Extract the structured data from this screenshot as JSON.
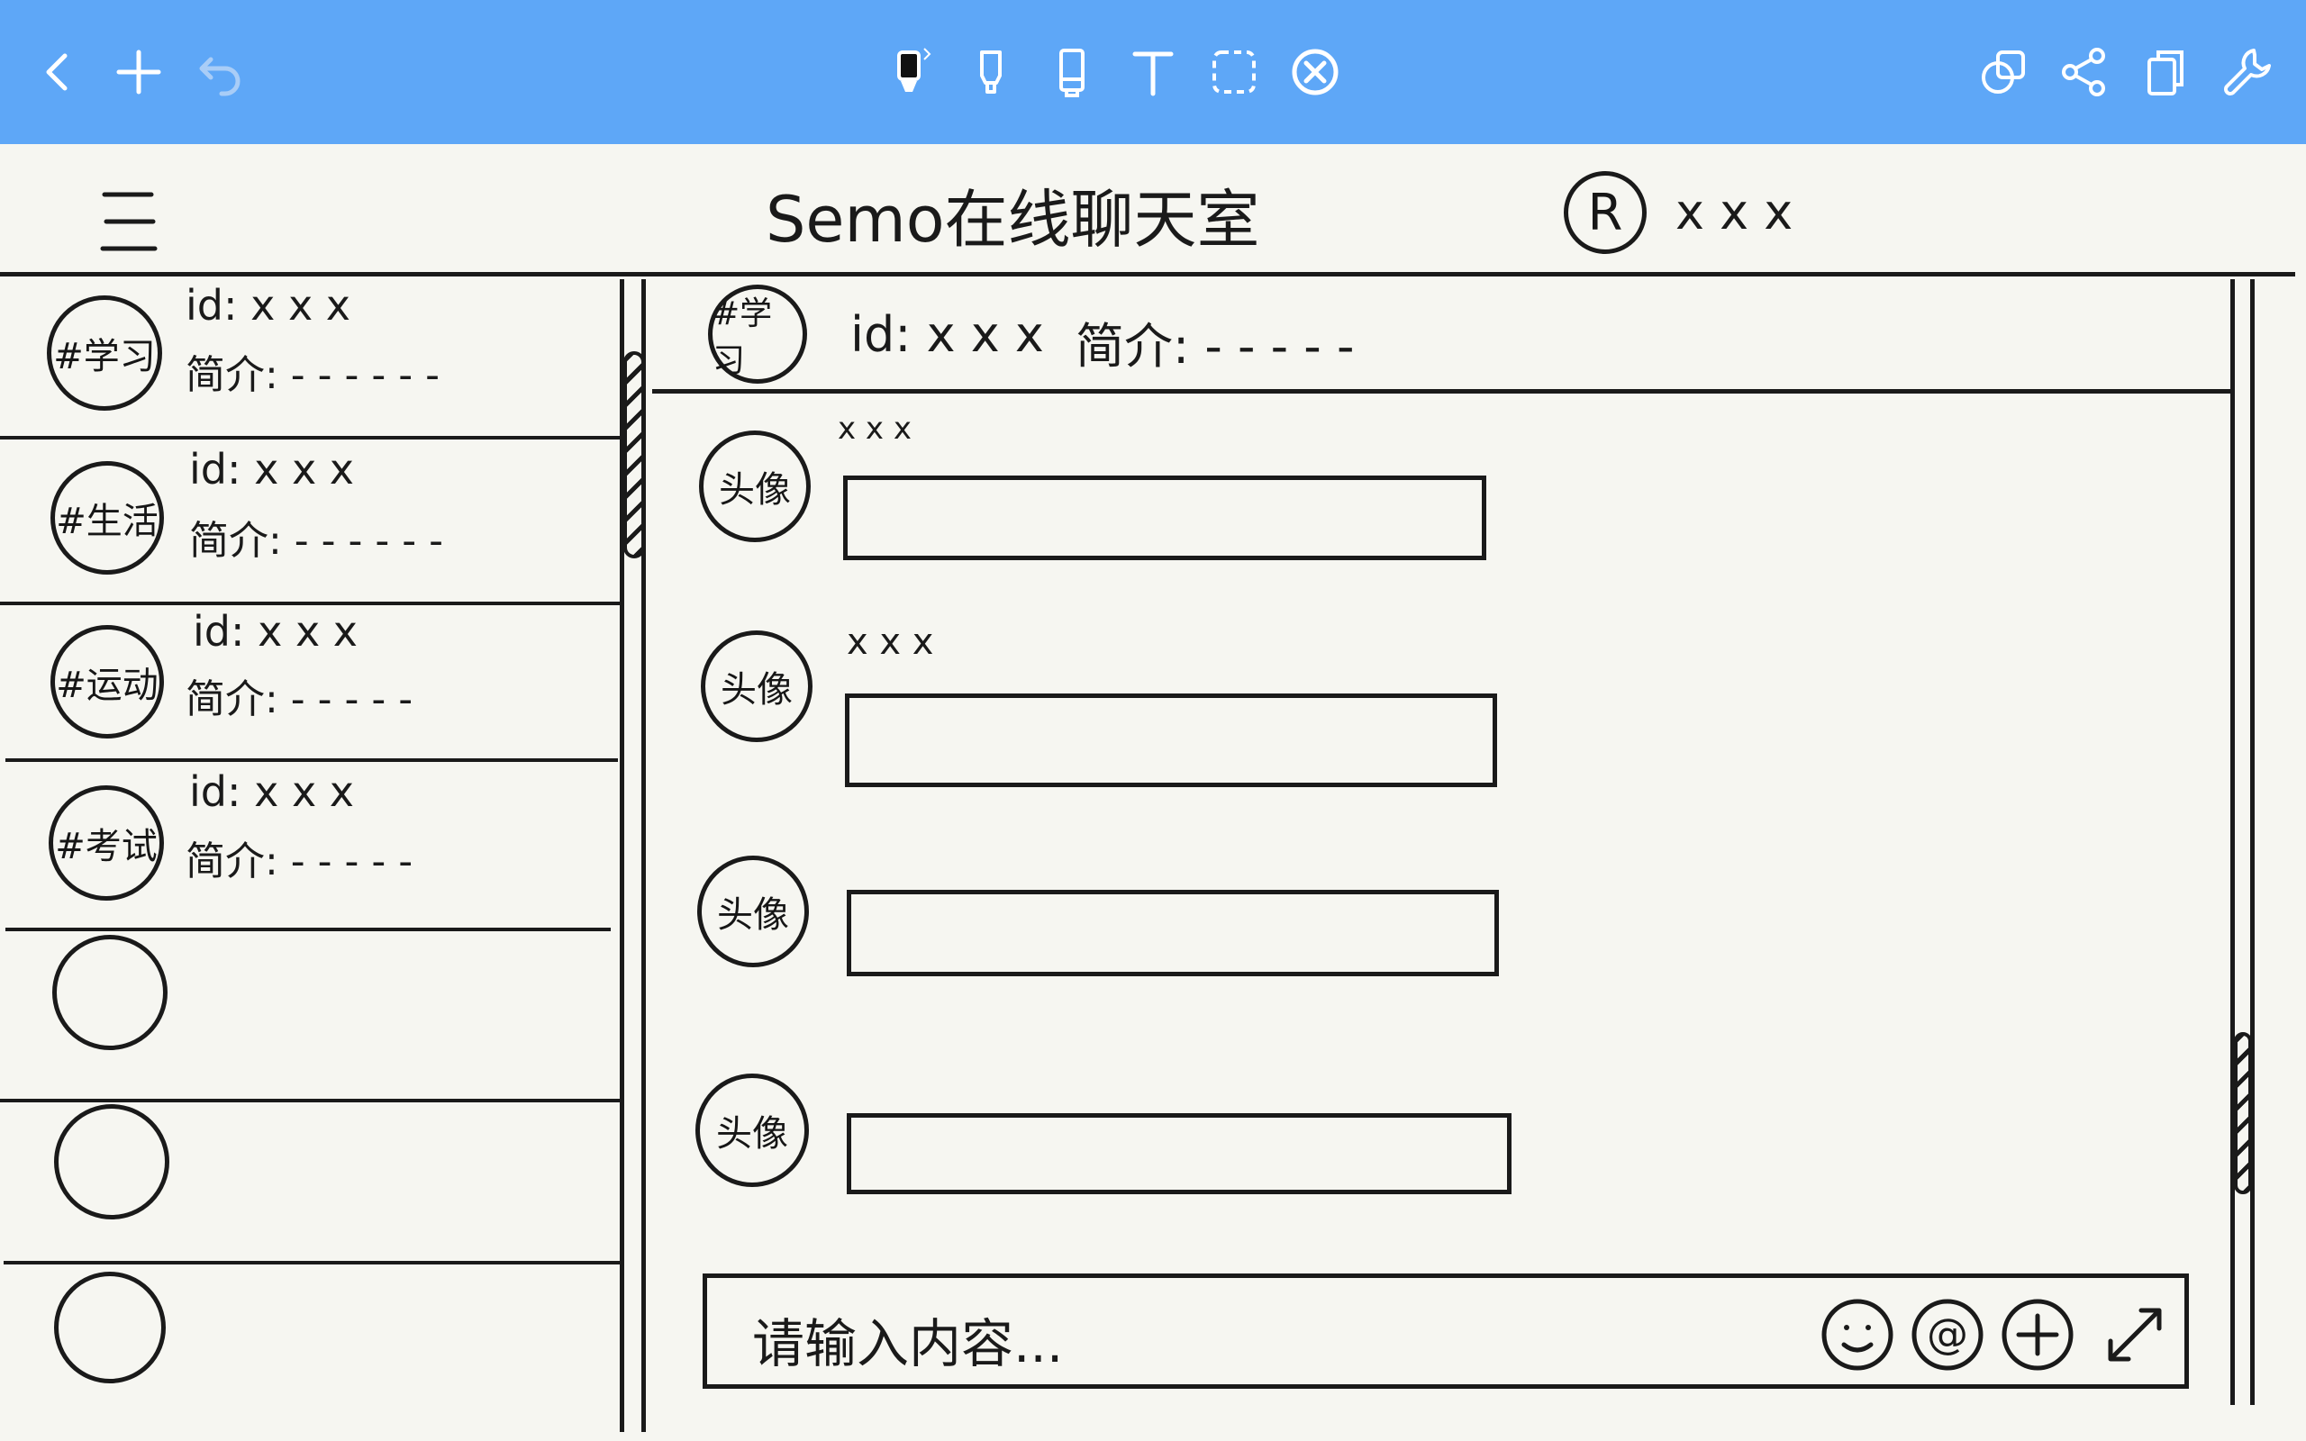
{
  "toolbar": {
    "left": [
      {
        "icon": "chevron-left-icon"
      },
      {
        "icon": "plus-icon"
      },
      {
        "icon": "undo-icon"
      }
    ],
    "tools": [
      {
        "icon": "pen-icon"
      },
      {
        "icon": "highlighter-icon"
      },
      {
        "icon": "eraser-icon"
      },
      {
        "icon": "text-icon"
      },
      {
        "icon": "lasso-icon"
      },
      {
        "icon": "close-circle-icon"
      }
    ],
    "right": [
      {
        "icon": "layers-icon"
      },
      {
        "icon": "share-icon"
      },
      {
        "icon": "pages-icon"
      },
      {
        "icon": "wrench-icon"
      }
    ],
    "color": "#5ea7f7"
  },
  "header": {
    "menu_icon": "menu-icon",
    "title": "Semo在线聊天室",
    "avatar_glyph": "R",
    "username": "x x x"
  },
  "sidebar": {
    "rooms": [
      {
        "tag": "#学习",
        "id": "id: x x x",
        "desc": "简介: - - - - - -"
      },
      {
        "tag": "#生活",
        "id": "id: x x x",
        "desc": "简介: - - - - - -"
      },
      {
        "tag": "#运动",
        "id": "id: x x x",
        "desc": "简介: - - - - -"
      },
      {
        "tag": "#考试",
        "id": "id: x x x",
        "desc": "简介: - - - - -"
      }
    ],
    "empty_slots": 3
  },
  "chat": {
    "room_tag": "#学习",
    "room_id": "id: x x x",
    "room_desc": "简介: - - - - -",
    "messages": [
      {
        "avatar": "头像",
        "name": "x x x"
      },
      {
        "avatar": "头像",
        "name": "x x x"
      },
      {
        "avatar": "头像",
        "name": ""
      },
      {
        "avatar": "头像",
        "name": ""
      }
    ],
    "input_placeholder": "请输入内容...",
    "input_tools": [
      "smile-icon",
      "at-icon",
      "plus-circle-icon",
      "expand-icon"
    ]
  }
}
